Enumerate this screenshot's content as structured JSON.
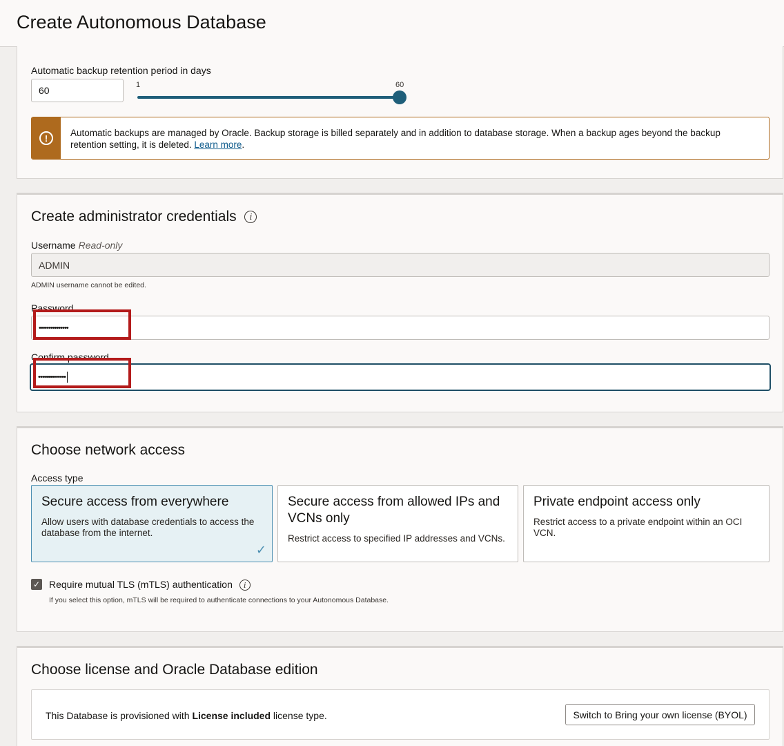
{
  "header": {
    "title": "Create Autonomous Database"
  },
  "backup": {
    "label": "Automatic backup retention period in days",
    "value": "60",
    "slider_min": "1",
    "slider_max": "60",
    "slider_fraction": 1.0,
    "notice_text": "Automatic backups are managed by Oracle. Backup storage is billed separately and in addition to database storage. When a backup ages beyond the backup retention setting, it is deleted.",
    "notice_link": "Learn more",
    "notice_icon": "warning-icon"
  },
  "credentials": {
    "title": "Create administrator credentials",
    "username_label": "Username",
    "username_readonly": "Read-only",
    "username_value": "ADMIN",
    "username_help": "ADMIN username cannot be edited.",
    "password_label": "Password",
    "password_value": "•••••••••••••••",
    "confirm_label": "Confirm password",
    "confirm_value": "••••••••••••••"
  },
  "network": {
    "title": "Choose network access",
    "access_type_label": "Access type",
    "options": [
      {
        "title": "Secure access from everywhere",
        "desc": "Allow users with database credentials to access the database from the internet.",
        "selected": true
      },
      {
        "title": "Secure access from allowed IPs and VCNs only",
        "desc": "Restrict access to specified IP addresses and VCNs.",
        "selected": false
      },
      {
        "title": "Private endpoint access only",
        "desc": "Restrict access to a private endpoint within an OCI VCN.",
        "selected": false
      }
    ],
    "mtls_label": "Require mutual TLS (mTLS) authentication",
    "mtls_checked": true,
    "mtls_help": "If you select this option, mTLS will be required to authenticate connections to your Autonomous Database."
  },
  "license": {
    "title": "Choose license and Oracle Database edition",
    "text_prefix": "This Database is provisioned with",
    "text_bold": "License included",
    "text_suffix": "license type.",
    "switch_button": "Switch to Bring your own license (BYOL)"
  },
  "colors": {
    "accent": "#1f5f7a",
    "warning": "#ae6a1e",
    "highlight": "#b31b1b",
    "selected_card_bg": "#e6f1f4"
  }
}
